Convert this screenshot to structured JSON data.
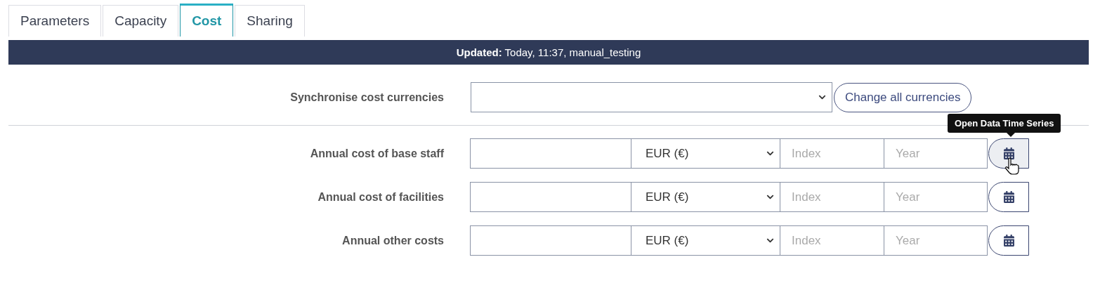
{
  "tabs": [
    {
      "label": "Parameters",
      "selected": false
    },
    {
      "label": "Capacity",
      "selected": false
    },
    {
      "label": "Cost",
      "selected": true
    },
    {
      "label": "Sharing",
      "selected": false
    }
  ],
  "banner": {
    "text": "**Updated:** Today, 11:37, manual_testing"
  },
  "sync": {
    "label": "Synchronise cost currencies",
    "button": "Change all currencies"
  },
  "rows": [
    {
      "label": "Annual cost of base staff",
      "currency": "EUR (€)",
      "index_placeholder": "Index",
      "year_placeholder": "Year",
      "hovered": true,
      "tooltip": "Open Data Time Series"
    },
    {
      "label": "Annual cost of facilities",
      "currency": "EUR (€)",
      "index_placeholder": "Index",
      "year_placeholder": "Year",
      "hovered": false
    },
    {
      "label": "Annual other costs",
      "currency": "EUR (€)",
      "index_placeholder": "Index",
      "year_placeholder": "Year",
      "hovered": false
    }
  ]
}
